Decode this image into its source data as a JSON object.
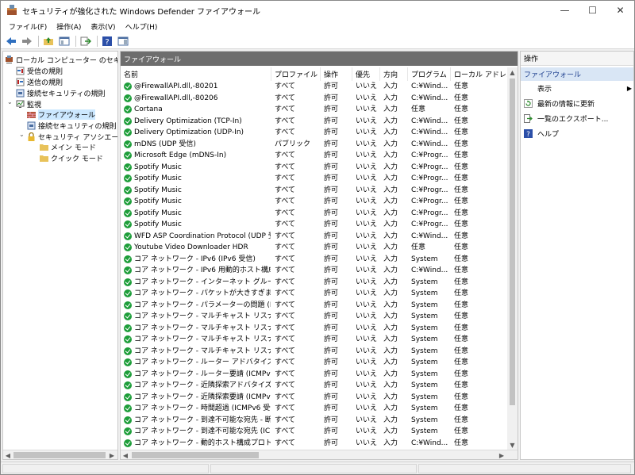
{
  "window": {
    "title": "セキュリティが強化された Windows Defender ファイアウォール",
    "buttons": {
      "minimize": "—",
      "maximize": "☐",
      "close": "✕"
    }
  },
  "menu": [
    "ファイル(F)",
    "操作(A)",
    "表示(V)",
    "ヘルプ(H)"
  ],
  "toolbar_icons": [
    "back-icon",
    "forward-icon",
    "up-folder-icon",
    "console-tree-icon",
    "export-icon",
    "help-icon",
    "properties-icon"
  ],
  "tree": {
    "root": "ローカル コンピューター のセキュリティ",
    "items": [
      {
        "label": "受信の規則",
        "icon": "inbound-icon"
      },
      {
        "label": "送信の規則",
        "icon": "outbound-icon"
      },
      {
        "label": "接続セキュリティの規則",
        "icon": "connection-rules-icon"
      },
      {
        "label": "監視",
        "icon": "monitor-icon"
      },
      {
        "label": "ファイアウォール",
        "icon": "firewall-icon"
      },
      {
        "label": "接続セキュリティの規則",
        "icon": "connection-rules-icon"
      },
      {
        "label": "セキュリティ アソシエーション",
        "icon": "lock-icon"
      },
      {
        "label": "メイン モード",
        "icon": "folder-icon"
      },
      {
        "label": "クイック モード",
        "icon": "folder-icon"
      }
    ]
  },
  "middle": {
    "title": "ファイアウォール",
    "columns": [
      "名前",
      "プロファイル",
      "操作",
      "優先",
      "方向",
      "プログラム",
      "ローカル アドレス"
    ],
    "rows": [
      [
        "@FirewallAPI.dll,-80201",
        "すべて",
        "許可",
        "いいえ",
        "入力",
        "C:¥Wind...",
        "任意"
      ],
      [
        "@FirewallAPI.dll,-80206",
        "すべて",
        "許可",
        "いいえ",
        "入力",
        "C:¥Wind...",
        "任意"
      ],
      [
        "Cortana",
        "すべて",
        "許可",
        "いいえ",
        "入力",
        "任意",
        "任意"
      ],
      [
        "Delivery Optimization (TCP-In)",
        "すべて",
        "許可",
        "いいえ",
        "入力",
        "C:¥Wind...",
        "任意"
      ],
      [
        "Delivery Optimization (UDP-In)",
        "すべて",
        "許可",
        "いいえ",
        "入力",
        "C:¥Wind...",
        "任意"
      ],
      [
        "mDNS (UDP 受信)",
        "パブリック",
        "許可",
        "いいえ",
        "入力",
        "C:¥Wind...",
        "任意"
      ],
      [
        "Microsoft Edge (mDNS-In)",
        "すべて",
        "許可",
        "いいえ",
        "入力",
        "C:¥Progr...",
        "任意"
      ],
      [
        "Spotify Music",
        "すべて",
        "許可",
        "いいえ",
        "入力",
        "C:¥Progr...",
        "任意"
      ],
      [
        "Spotify Music",
        "すべて",
        "許可",
        "いいえ",
        "入力",
        "C:¥Progr...",
        "任意"
      ],
      [
        "Spotify Music",
        "すべて",
        "許可",
        "いいえ",
        "入力",
        "C:¥Progr...",
        "任意"
      ],
      [
        "Spotify Music",
        "すべて",
        "許可",
        "いいえ",
        "入力",
        "C:¥Progr...",
        "任意"
      ],
      [
        "Spotify Music",
        "すべて",
        "許可",
        "いいえ",
        "入力",
        "C:¥Progr...",
        "任意"
      ],
      [
        "Spotify Music",
        "すべて",
        "許可",
        "いいえ",
        "入力",
        "C:¥Progr...",
        "任意"
      ],
      [
        "WFD ASP Coordination Protocol (UDP 受...",
        "すべて",
        "許可",
        "いいえ",
        "入力",
        "C:¥Wind...",
        "任意"
      ],
      [
        "Youtube Video Downloader HDR",
        "すべて",
        "許可",
        "いいえ",
        "入力",
        "任意",
        "任意"
      ],
      [
        "コア ネットワーク - IPv6 (IPv6 受信)",
        "すべて",
        "許可",
        "いいえ",
        "入力",
        "System",
        "任意"
      ],
      [
        "コア ネットワーク - IPv6 用動的ホスト構成プロ...",
        "すべて",
        "許可",
        "いいえ",
        "入力",
        "C:¥Wind...",
        "任意"
      ],
      [
        "コア ネットワーク - インターネット グループ管理プ...",
        "すべて",
        "許可",
        "いいえ",
        "入力",
        "System",
        "任意"
      ],
      [
        "コア ネットワーク - パケットが大きすぎます (ICM...",
        "すべて",
        "許可",
        "いいえ",
        "入力",
        "System",
        "任意"
      ],
      [
        "コア ネットワーク - パラメーターの問題 (ICMPv6...",
        "すべて",
        "許可",
        "いいえ",
        "入力",
        "System",
        "任意"
      ],
      [
        "コア ネットワーク - マルチキャスト リスナー クエリ...",
        "すべて",
        "許可",
        "いいえ",
        "入力",
        "System",
        "任意"
      ],
      [
        "コア ネットワーク - マルチキャスト リスナー レポー...",
        "すべて",
        "許可",
        "いいえ",
        "入力",
        "System",
        "任意"
      ],
      [
        "コア ネットワーク - マルチキャスト リスナー レポー...",
        "すべて",
        "許可",
        "いいえ",
        "入力",
        "System",
        "任意"
      ],
      [
        "コア ネットワーク - マルチキャスト リスナー完了 (I...",
        "すべて",
        "許可",
        "いいえ",
        "入力",
        "System",
        "任意"
      ],
      [
        "コア ネットワーク - ルーター アドバタイズ (ICMPv...",
        "すべて",
        "許可",
        "いいえ",
        "入力",
        "System",
        "任意"
      ],
      [
        "コア ネットワーク - ルーター要請 (ICMPv6-受信)",
        "すべて",
        "許可",
        "いいえ",
        "入力",
        "System",
        "任意"
      ],
      [
        "コア ネットワーク - 近隣探索アドバタイズ (ICMP...",
        "すべて",
        "許可",
        "いいえ",
        "入力",
        "System",
        "任意"
      ],
      [
        "コア ネットワーク - 近隣探索要請 (ICMPv6 受...",
        "すべて",
        "許可",
        "いいえ",
        "入力",
        "System",
        "任意"
      ],
      [
        "コア ネットワーク - 時間超過 (ICMPv6 受信)",
        "すべて",
        "許可",
        "いいえ",
        "入力",
        "System",
        "任意"
      ],
      [
        "コア ネットワーク - 到達不可能な宛先 - 断片...",
        "すべて",
        "許可",
        "いいえ",
        "入力",
        "System",
        "任意"
      ],
      [
        "コア ネットワーク - 到達不可能な宛先 (ICMR...",
        "すべて",
        "許可",
        "いいえ",
        "入力",
        "System",
        "任意"
      ],
      [
        "コア ネットワーク - 動的ホスト構成プロトコル (D...",
        "すべて",
        "許可",
        "いいえ",
        "入力",
        "C:¥Wind...",
        "任意"
      ]
    ]
  },
  "actions": {
    "title": "操作",
    "section": "ファイアウォール",
    "items": [
      {
        "label": "表示",
        "icon": "view-icon",
        "submenu": true
      },
      {
        "label": "最新の情報に更新",
        "icon": "refresh-icon",
        "submenu": false
      },
      {
        "label": "一覧のエクスポート...",
        "icon": "export-icon",
        "submenu": false
      },
      {
        "label": "ヘルプ",
        "icon": "help-icon",
        "submenu": false
      }
    ]
  }
}
